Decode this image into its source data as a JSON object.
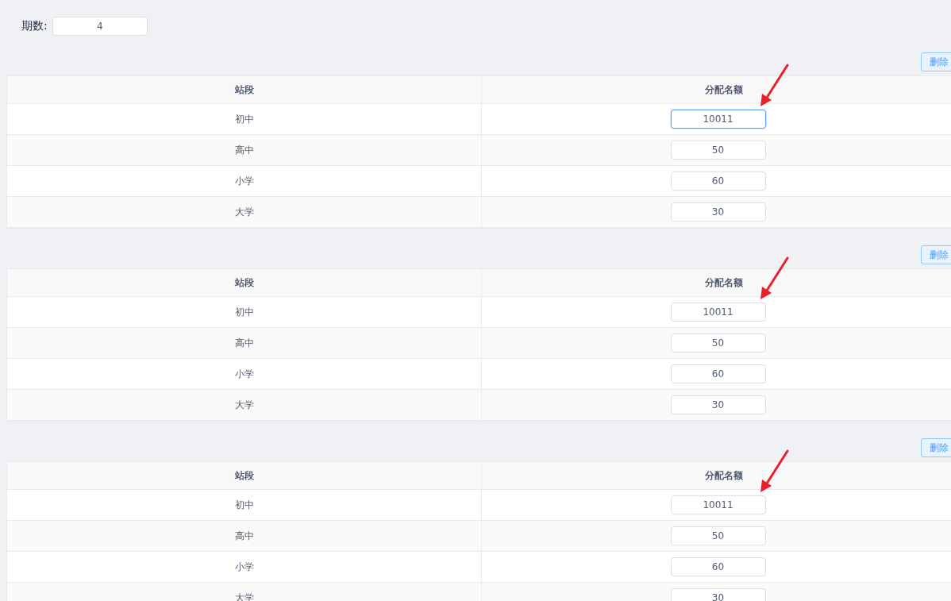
{
  "periods": {
    "label": "期数:",
    "value": "4"
  },
  "blocks": [
    {
      "delete_button": "删除",
      "columns": [
        "站段",
        "分配名额"
      ],
      "rows": [
        {
          "stage": "初中",
          "quota": "10011",
          "focused": true
        },
        {
          "stage": "高中",
          "quota": "50",
          "focused": false
        },
        {
          "stage": "小学",
          "quota": "60",
          "focused": false
        },
        {
          "stage": "大学",
          "quota": "30",
          "focused": false
        }
      ]
    },
    {
      "delete_button": "删除",
      "columns": [
        "站段",
        "分配名额"
      ],
      "rows": [
        {
          "stage": "初中",
          "quota": "10011",
          "focused": false
        },
        {
          "stage": "高中",
          "quota": "50",
          "focused": false
        },
        {
          "stage": "小学",
          "quota": "60",
          "focused": false
        },
        {
          "stage": "大学",
          "quota": "30",
          "focused": false
        }
      ]
    },
    {
      "delete_button": "删除",
      "columns": [
        "站段",
        "分配名额"
      ],
      "rows": [
        {
          "stage": "初中",
          "quota": "10011",
          "focused": false
        },
        {
          "stage": "高中",
          "quota": "50",
          "focused": false
        },
        {
          "stage": "小学",
          "quota": "60",
          "focused": false
        },
        {
          "stage": "大学",
          "quota": "30",
          "focused": false
        }
      ]
    }
  ]
}
